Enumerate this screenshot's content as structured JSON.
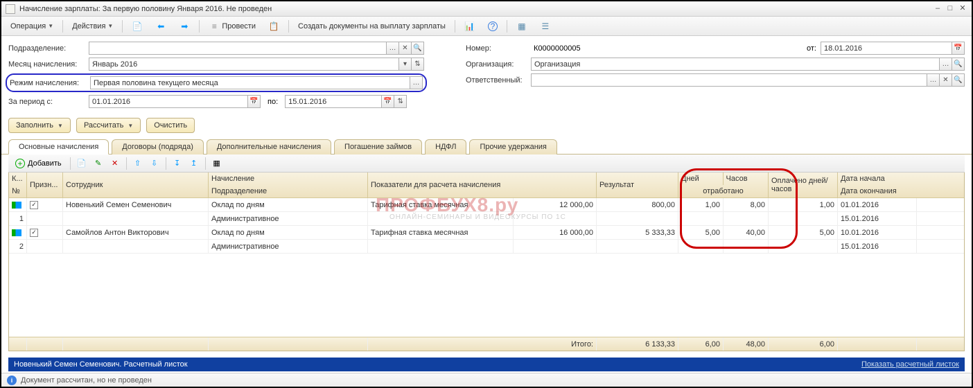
{
  "window": {
    "title": "Начисление зарплаты: За первую половину Января 2016. Не проведен"
  },
  "toolbar": {
    "operation": "Операция",
    "actions": "Действия",
    "conduct": "Провести",
    "create_docs": "Создать документы на выплату зарплаты"
  },
  "form": {
    "dept_label": "Подразделение:",
    "dept_value": "",
    "month_label": "Месяц начисления:",
    "month_value": "Январь 2016",
    "mode_label": "Режим начисления:",
    "mode_value": "Первая половина текущего месяца",
    "period_label": "За период с:",
    "from": "01.01.2016",
    "to_label": "по:",
    "to": "15.01.2016",
    "num_label": "Номер:",
    "num_value": "К0000000005",
    "date_label": "от:",
    "date_value": "18.01.2016",
    "org_label": "Организация:",
    "org_value": "Организация",
    "resp_label": "Ответственный:",
    "resp_value": ""
  },
  "buttons": {
    "fill": "Заполнить",
    "calc": "Рассчитать",
    "clear": "Очистить"
  },
  "tabs": [
    "Основные начисления",
    "Договоры (подряда)",
    "Дополнительные начисления",
    "Погашение займов",
    "НДФЛ",
    "Прочие удержания"
  ],
  "grid_toolbar": {
    "add": "Добавить"
  },
  "headers": {
    "k": "К...",
    "sign": "Призн...",
    "num": "№",
    "emp": "Сотрудник",
    "acc": "Начисление",
    "dept": "Подразделение",
    "ind": "Показатели для расчета начисления",
    "res": "Результат",
    "days": "Дней",
    "hours": "Часов",
    "worked": "отработано",
    "paid": "Оплачено дней/часов",
    "dstart": "Дата начала",
    "dend": "Дата окончания"
  },
  "rows": [
    {
      "n": "1",
      "emp": "Новенький Семен Семенович",
      "acc": "Оклад по дням",
      "dept": "Административное",
      "ind": "Тарифная ставка месячная",
      "ind_val": "12 000,00",
      "res": "800,00",
      "days": "1,00",
      "hours": "8,00",
      "paid": "1,00",
      "d1": "01.01.2016",
      "d2": "15.01.2016"
    },
    {
      "n": "2",
      "emp": "Самойлов Антон Викторович",
      "acc": "Оклад по дням",
      "dept": "Административное",
      "ind": "Тарифная ставка месячная",
      "ind_val": "16 000,00",
      "res": "5 333,33",
      "days": "5,00",
      "hours": "40,00",
      "paid": "5,00",
      "d1": "10.01.2016",
      "d2": "15.01.2016"
    }
  ],
  "totals": {
    "label": "Итого:",
    "res": "6 133,33",
    "days": "6,00",
    "hours": "48,00",
    "paid": "6,00"
  },
  "bottom": {
    "emp": "Новенький Семен Семенович. Расчетный листок",
    "link": "Показать расчетный листок"
  },
  "status": {
    "text": "Документ рассчитан, но не проведен"
  },
  "watermark": {
    "main": "ПРОФБУХ8.ру",
    "sub": "ОНЛАЙН-СЕМИНАРЫ И ВИДЕОКУРСЫ ПО 1С"
  }
}
